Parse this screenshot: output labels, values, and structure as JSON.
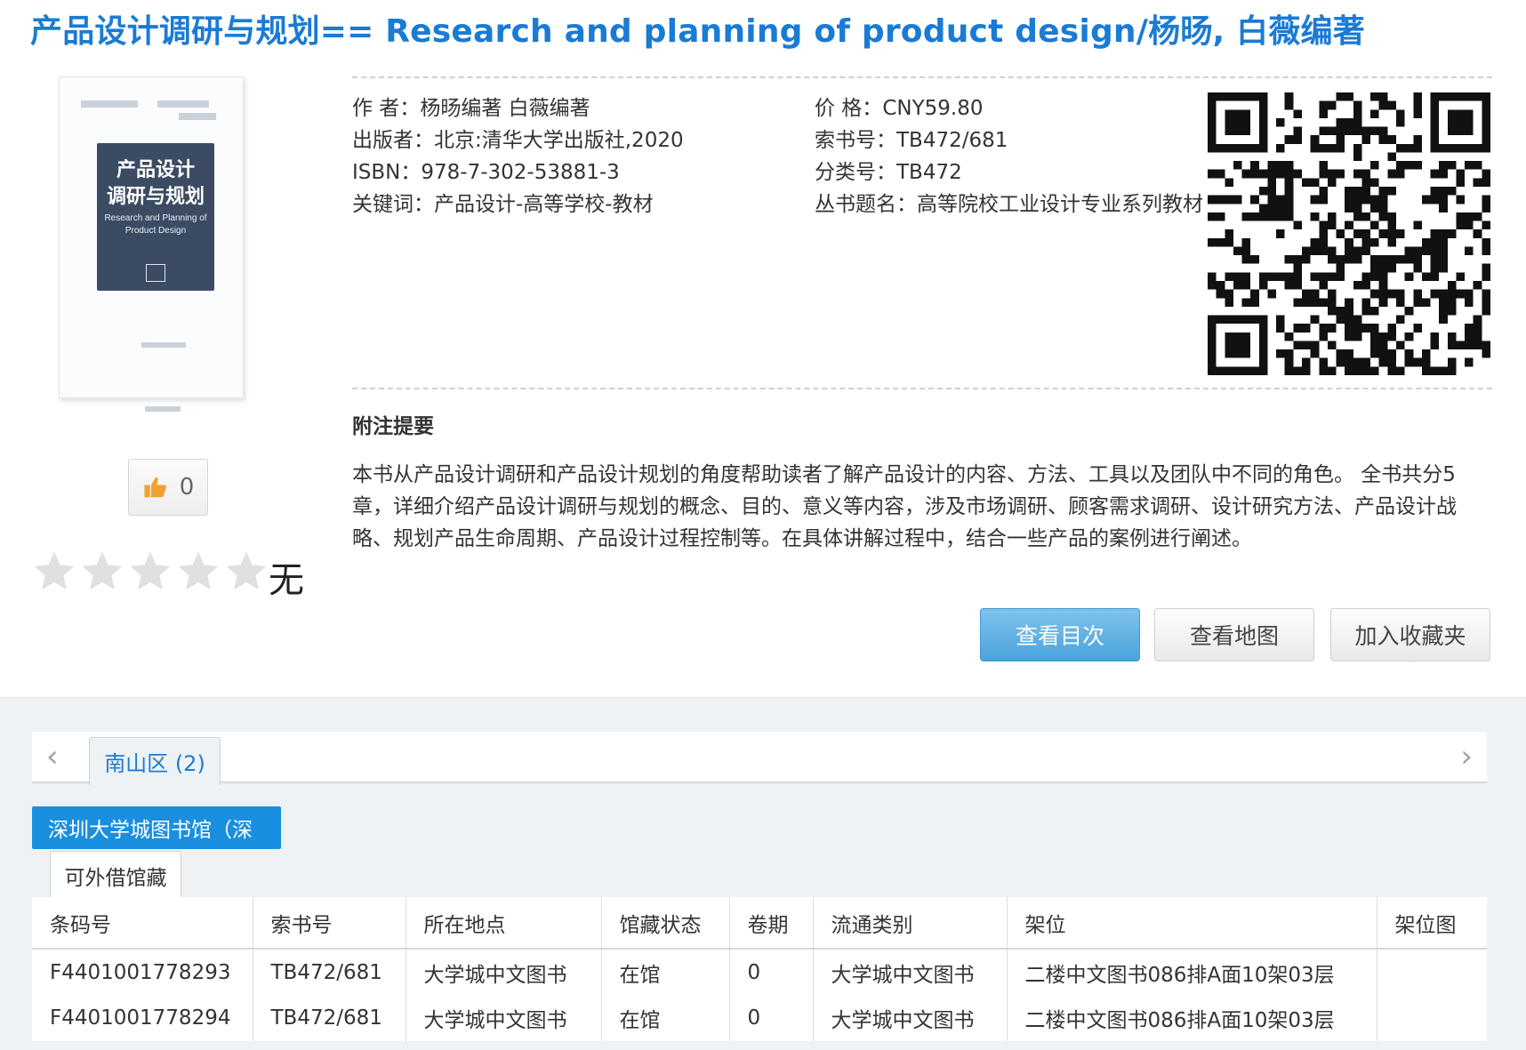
{
  "title": "产品设计调研与规划== Research and planning of product design/杨旸, 白薇编著",
  "cover": {
    "title_line1": "产品设计",
    "title_line2": "调研与规划",
    "english": "Research and Planning of Product Design"
  },
  "meta_left": [
    {
      "label": "作 者：",
      "value": "杨旸编著 白薇编著"
    },
    {
      "label": "出版者：",
      "value": "北京:清华大学出版社,2020"
    },
    {
      "label": "ISBN：",
      "value": "978-7-302-53881-3"
    },
    {
      "label": "关键词：",
      "value": "产品设计-高等学校-教材"
    }
  ],
  "meta_right": [
    {
      "label": "价 格：",
      "value": "CNY59.80"
    },
    {
      "label": "索书号：",
      "value": "TB472/681"
    },
    {
      "label": "分类号：",
      "value": "TB472"
    },
    {
      "label": "丛书题名：",
      "value": "高等院校工业设计专业系列教材"
    }
  ],
  "note": {
    "heading": "附注提要",
    "body": "本书从产品设计调研和产品设计规划的角度帮助读者了解产品设计的内容、方法、工具以及团队中不同的角色。 全书共分5章，详细介绍产品设计调研与规划的概念、目的、意义等内容，涉及市场调研、顾客需求调研、设计研究方法、产品设计战略、规划产品生命周期、产品设计过程控制等。在具体讲解过程中，结合一些产品的案例进行阐述。"
  },
  "like": {
    "count": "0"
  },
  "rating": {
    "stars_filled": 0,
    "stars_total": 5,
    "text": "无"
  },
  "buttons": {
    "toc": "查看目次",
    "map": "查看地图",
    "favorite": "加入收藏夹"
  },
  "holdings": {
    "region_tab": "南山区 (2)",
    "library_tab": "深圳大学城图书馆（深",
    "sub_tab": "可外借馆藏",
    "columns": [
      "条码号",
      "索书号",
      "所在地点",
      "馆藏状态",
      "卷期",
      "流通类别",
      "架位",
      "架位图"
    ],
    "rows": [
      [
        "F4401001778293",
        "TB472/681",
        "大学城中文图书",
        "在馆",
        "0",
        "大学城中文图书",
        "二楼中文图书086排A面10架03层",
        ""
      ],
      [
        "F4401001778294",
        "TB472/681",
        "大学城中文图书",
        "在馆",
        "0",
        "大学城中文图书",
        "二楼中文图书086排A面10架03层",
        ""
      ]
    ]
  },
  "colors": {
    "accent": "#1a7bd4",
    "primary_button": "#4aa3dc",
    "library_tab": "#1a8fe0"
  },
  "icons": [
    "thumbs-up-icon",
    "star-icon",
    "chevron-left-icon",
    "chevron-right-icon",
    "qr-code"
  ]
}
